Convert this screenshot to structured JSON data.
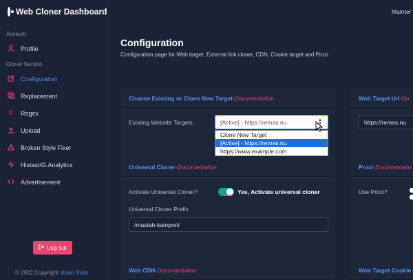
{
  "app": {
    "title": "Web Cloner Dashboard"
  },
  "topbar": {
    "user_text": "Mainter"
  },
  "sidebar": {
    "account_label": "Account",
    "cloner_label": "Cloner Section",
    "items": [
      {
        "label": "Profile",
        "icon": "user-icon"
      },
      {
        "label": "Configuration",
        "icon": "edit-icon",
        "active": true
      },
      {
        "label": "Replacement",
        "icon": "copy-icon"
      },
      {
        "label": "Regex",
        "icon": "hash-icon"
      },
      {
        "label": "Upload",
        "icon": "upload-icon"
      },
      {
        "label": "Broken Style Fixer",
        "icon": "warning-icon"
      },
      {
        "label": "Histast/G.Analytics",
        "icon": "activity-icon"
      },
      {
        "label": "Advertisement",
        "icon": "code-icon"
      }
    ],
    "logout_label": "Log out",
    "copyright_prefix": "© 2022 Copyright.",
    "copyright_link": "Koon.Tools"
  },
  "page": {
    "title": "Configuration",
    "subtitle": "Configuration page for Web target, External link cloner, CDN, Cookie target and Proxi"
  },
  "cards": {
    "choose": {
      "title": "Choose Existing or Clone New Target",
      "sep": " - ",
      "doc": "Documentation",
      "field_label": "Existing Website Targets",
      "selected": "[Active] - https://remas.nu",
      "options": [
        "Clone New Target",
        "[Active] - https://remas.nu",
        "https://www.example.com"
      ]
    },
    "target_url": {
      "title": "Web Target Url",
      "sep": " - ",
      "doc": "Do",
      "value": "https://remas.nu"
    },
    "universal": {
      "title": "Universal Cloner",
      "sep": " - ",
      "doc": "Documentation",
      "activate_label": "Activate Universal Cloner?",
      "toggle_text": "Yes, Activate universal cloner",
      "prefix_label": "Universal Cloner Prefix",
      "prefix_value": "/mastah-kampret/"
    },
    "proxi": {
      "title": "Proxi",
      "sep": " - ",
      "doc": "Documentatio",
      "use_label": "Use Proxi?"
    },
    "cdn": {
      "title": "Web CDN",
      "sep": " - ",
      "doc": "Documentation"
    },
    "cookie": {
      "title": "Web Target Cookie"
    }
  },
  "colors": {
    "accent_blue": "#4d8df7",
    "accent_pink": "#e8466f",
    "toggle_green": "#1aa386",
    "background": "#1a2236"
  }
}
